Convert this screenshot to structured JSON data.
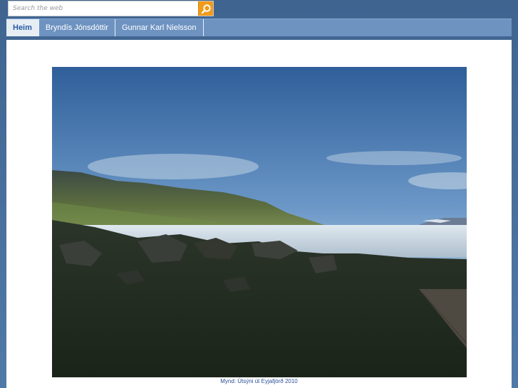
{
  "search": {
    "placeholder": "Search the web",
    "button_icon": "search-icon",
    "button_color": "#f19b1a"
  },
  "nav": {
    "tabs": [
      {
        "label": "Heim",
        "active": true
      },
      {
        "label": "Bryndís Jónsdóttir",
        "active": false
      },
      {
        "label": "Gunnar Karl Nielsson",
        "active": false
      }
    ]
  },
  "main": {
    "caption": "Mynd: Útsýni út Eyjafjörð 2010"
  },
  "colors": {
    "background": "#4a6e9a",
    "nav_bar": "#6e93c1",
    "active_tab": "#e6eef4",
    "caption_text": "#2c4f9a"
  }
}
